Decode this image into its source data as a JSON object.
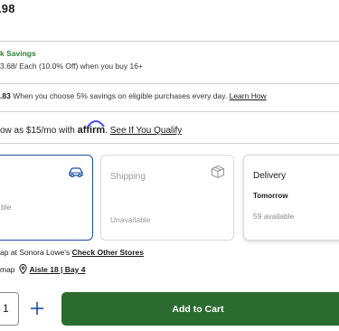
{
  "product": {
    "price": ".98"
  },
  "bulk_savings": {
    "title": "k Savings",
    "detail": "3.68/ Each (10.0% Off) when you buy 16+"
  },
  "card_savings": {
    "amount": ".83",
    "text": " When you choose 5% savings on eligible purchases every day. ",
    "link": "Learn How"
  },
  "financing": {
    "prefix": "ow as $15/mo with ",
    "brand": "affirm",
    "separator": ". ",
    "link": "See If You Qualify"
  },
  "fulfillment": {
    "pickup": {
      "icon": "car-icon",
      "status": "ble"
    },
    "shipping": {
      "icon": "box-icon",
      "title": "Shipping",
      "status": "Unavailable"
    },
    "delivery": {
      "title": "Delivery",
      "when": "Tomorrow",
      "status": "59 available"
    }
  },
  "store": {
    "text": "ap at Sonora Lowe's ",
    "link": "Check Other Stores",
    "map_prefix": "map",
    "aisle": "Aisle 18 | Bay 4"
  },
  "purchase": {
    "quantity": "1",
    "add_to_cart": "Add to Cart"
  },
  "colors": {
    "accent_blue": "#1a4fa0",
    "savings_green": "#2f7d32",
    "cart_green": "#2c6b2f"
  }
}
